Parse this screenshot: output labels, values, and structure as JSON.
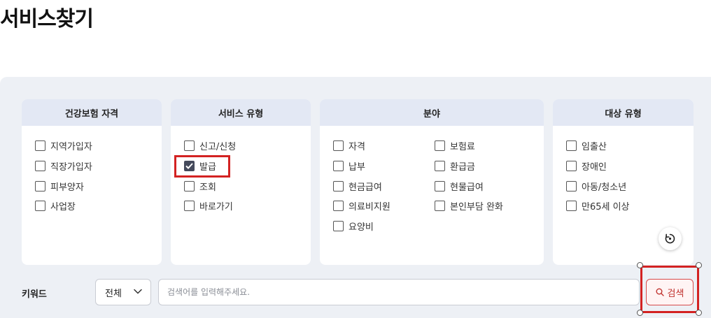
{
  "page": {
    "title": "서비스찾기"
  },
  "panels": [
    {
      "id": "eligibility",
      "title": "건강보험 자격",
      "items": [
        {
          "label": "지역가입자",
          "checked": false
        },
        {
          "label": "직장가입자",
          "checked": false
        },
        {
          "label": "피부양자",
          "checked": false
        },
        {
          "label": "사업장",
          "checked": false
        }
      ]
    },
    {
      "id": "service-type",
      "title": "서비스 유형",
      "items": [
        {
          "label": "신고/신청",
          "checked": false
        },
        {
          "label": "발급",
          "checked": true
        },
        {
          "label": "조회",
          "checked": false
        },
        {
          "label": "바로가기",
          "checked": false
        }
      ]
    },
    {
      "id": "field",
      "title": "분야",
      "items": [
        {
          "label": "자격",
          "checked": false
        },
        {
          "label": "납부",
          "checked": false
        },
        {
          "label": "현금급여",
          "checked": false
        },
        {
          "label": "의료비지원",
          "checked": false
        },
        {
          "label": "요양비",
          "checked": false
        },
        {
          "label": "보험료",
          "checked": false
        },
        {
          "label": "환급금",
          "checked": false
        },
        {
          "label": "현물급여",
          "checked": false
        },
        {
          "label": "본인부담 완화",
          "checked": false
        }
      ]
    },
    {
      "id": "target-type",
      "title": "대상 유형",
      "items": [
        {
          "label": "임출산",
          "checked": false
        },
        {
          "label": "장애인",
          "checked": false
        },
        {
          "label": "아동/청소년",
          "checked": false
        },
        {
          "label": "만65세 이상",
          "checked": false
        }
      ]
    }
  ],
  "reset": {
    "icon": "refresh-icon"
  },
  "keyword": {
    "label": "키워드",
    "select_value": "전체",
    "placeholder": "검색어를 입력해주세요.",
    "value": ""
  },
  "search_button": {
    "label": "검색",
    "icon": "search-icon",
    "border_color": "#d74a4a"
  },
  "annotation_color": "#d32222"
}
